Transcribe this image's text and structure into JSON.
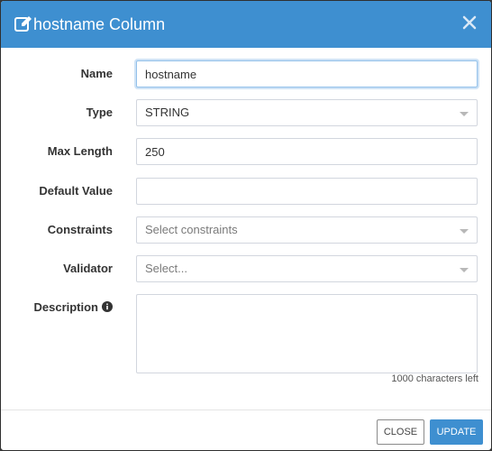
{
  "colors": {
    "header_bg": "#3e8fd0",
    "primary": "#3e8fd0",
    "focus_border": "#93c1ea"
  },
  "header": {
    "icon": "edit-icon",
    "title": "hostname Column",
    "close_icon": "close-icon"
  },
  "form": {
    "name": {
      "label": "Name",
      "value": "hostname"
    },
    "type": {
      "label": "Type",
      "value": "STRING"
    },
    "max_length": {
      "label": "Max Length",
      "value": "250"
    },
    "default_value": {
      "label": "Default Value",
      "value": ""
    },
    "constraints": {
      "label": "Constraints",
      "placeholder": "Select constraints"
    },
    "validator": {
      "label": "Validator",
      "placeholder": "Select..."
    },
    "description": {
      "label": "Description",
      "info_icon": "info-icon",
      "value": "",
      "counter": "1000 characters left"
    }
  },
  "footer": {
    "close_label": "CLOSE",
    "update_label": "UPDATE"
  }
}
